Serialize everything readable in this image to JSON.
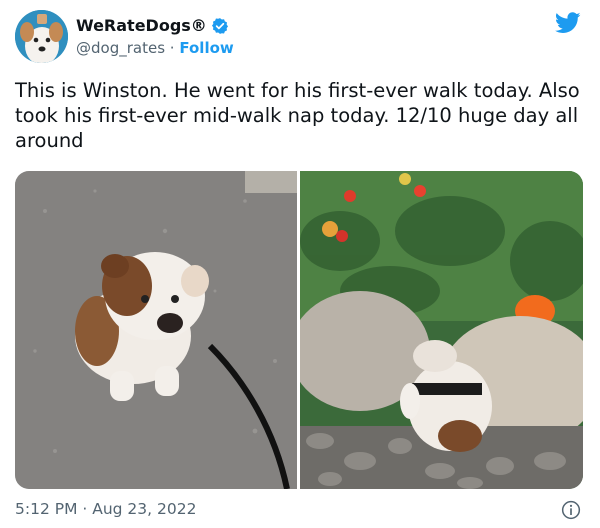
{
  "user": {
    "display_name": "WeRateDogs®",
    "handle": "@dog_rates",
    "separator": "·",
    "follow_label": "Follow"
  },
  "tweet": {
    "text": "This is Winston. He went for his first-ever walk today. Also took his first-ever mid-walk nap today. 12/10 huge day all around"
  },
  "footer": {
    "timestamp": "5:12 PM · Aug 23, 2022"
  },
  "icons": {
    "brand": "twitter-bird-icon",
    "verified": "verified-badge-icon",
    "info": "info-icon"
  },
  "colors": {
    "accent": "#1d9bf0",
    "text": "#0f1419",
    "muted": "#536471"
  }
}
